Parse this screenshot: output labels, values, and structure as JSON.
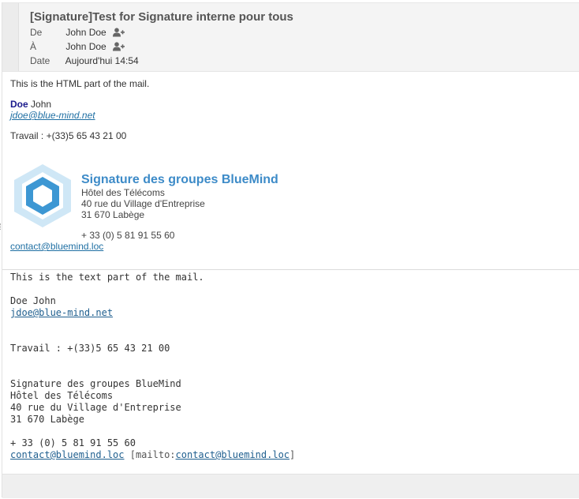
{
  "message": {
    "subject": "[Signature]Test for Signature interne pour tous",
    "from_label": "De",
    "from_value": "John Doe",
    "to_label": "À",
    "to_value": "John Doe",
    "date_label": "Date",
    "date_value": "Aujourd'hui 14:54"
  },
  "html_part": {
    "intro": "This is the HTML part of the mail.",
    "name_last": "Doe",
    "name_first": "John",
    "email": "jdoe@blue-mind.net",
    "work_phone": "Travail : +(33)5 65 43 21 00",
    "signature": {
      "title": "Signature des groupes BlueMind",
      "org": "Hôtel des Télécoms",
      "street": "40 rue du Village d'Entreprise",
      "city": "31 670 Labège",
      "phone": "+ 33 (0) 5 81 91 55 60",
      "contact": "contact@bluemind.loc"
    }
  },
  "text_part": {
    "intro": "This is the text part of the mail.",
    "name": "Doe John",
    "email": "jdoe@blue-mind.net",
    "work_phone": "Travail : +(33)5 65 43 21 00",
    "sig_title": "Signature des groupes BlueMind",
    "org": "Hôtel des Télécoms",
    "street": "40 rue du Village d'Entreprise",
    "city": "31 670 Labège",
    "phone": "+ 33 (0) 5 81 91 55 60",
    "contact": "contact@bluemind.loc",
    "mailto_prefix": " [mailto:",
    "mailto_link": "contact@bluemind.loc",
    "mailto_suffix": "]"
  },
  "colors": {
    "link": "#1f6fa3",
    "signature_title": "#3d8bc8",
    "header_bg": "#f4f4f4"
  }
}
